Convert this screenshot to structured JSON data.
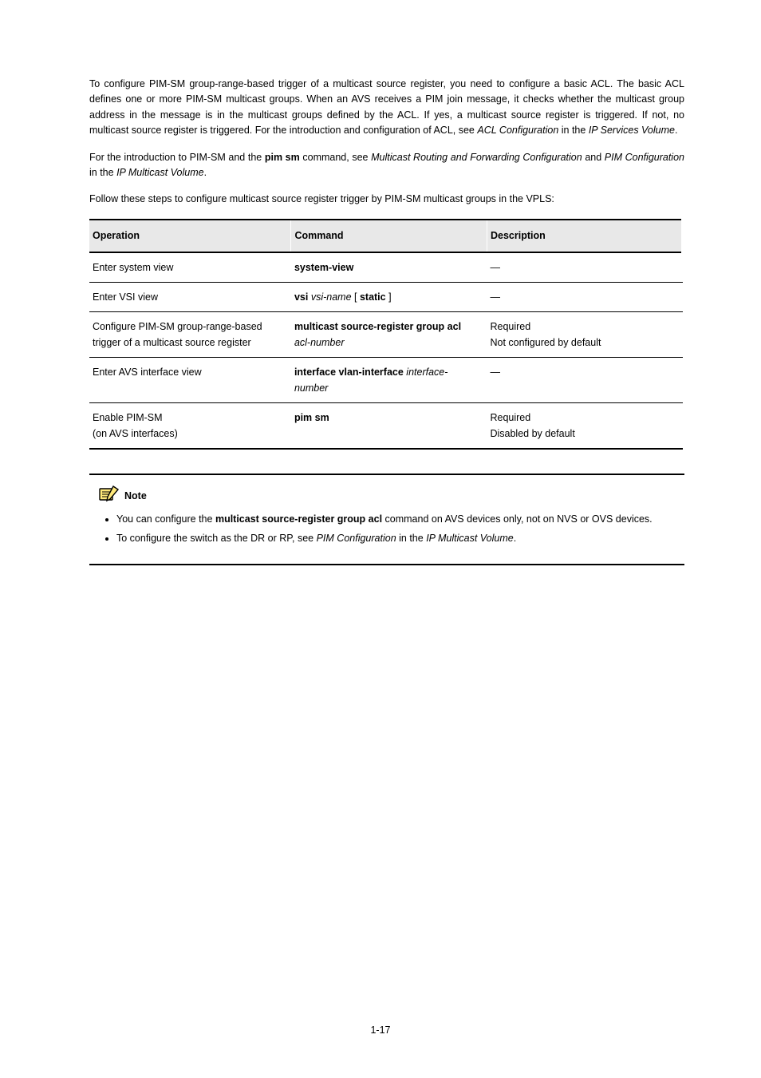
{
  "para1_pre": "To configure PIM-SM group-range-based trigger of a multicast source register, you need to configure a basic ACL. The basic ACL defines one or more PIM-SM multicast groups. When an AVS receives a PIM join message, it checks whether the multicast group address in the message is in the multicast groups defined by the ACL. If yes, a multicast source register is triggered. If not, no multicast source register is triggered. For the introduction and configuration of ACL, see ",
  "para1_link": "ACL Configuration",
  "para1_post": " in the ",
  "para1_em": "IP Services Volume",
  "para1_tail": ".",
  "para2_pre": "For the introduction to PIM-SM and the ",
  "para2_bold": "pim sm",
  "para2_mid": " command, see ",
  "para2_link": "Multicast Routing and Forwarding Configuration",
  "para2_post": " and ",
  "para2_link2": "PIM Configuration",
  "para2_post2": " in the ",
  "para2_em": "IP Multicast Volume",
  "para2_tail": ".",
  "table_caption_pre": "Follow these steps to configure multicast source register trigger by PIM-SM multicast groups in the VPLS:",
  "table": {
    "headers": [
      "Operation",
      "Command",
      "Description"
    ],
    "rows": [
      {
        "op": "Enter system view",
        "cmd_bold": "system-view",
        "cmd_arg": "",
        "desc": "—"
      },
      {
        "op": "Enter VSI view",
        "cmd_bold": "vsi",
        "cmd_arg": " vsi-name ",
        "cmd_tail": "[ ",
        "cmd_bold2": "static",
        "cmd_tail2": " ]",
        "desc": "—"
      },
      {
        "op": "Configure PIM-SM group-range-based trigger of a multicast source register",
        "cmd_bold": "multicast source-register group acl",
        "cmd_arg": " acl-number",
        "desc": "Required\nNot configured by default"
      },
      {
        "op": "Enter AVS interface view",
        "cmd_bold": "interface vlan-interface",
        "cmd_arg": " interface-number",
        "desc": "—"
      },
      {
        "op_line1": "Enable PIM-SM",
        "op_line2": "(on AVS interfaces)",
        "cmd_bold": "pim sm",
        "desc": "Required\nDisabled by default"
      }
    ]
  },
  "note_label": "Note",
  "note_items": [
    {
      "pre": "You can configure the ",
      "bold": "multicast source-register group acl",
      "post": " command on AVS devices only, not on NVS or OVS devices."
    },
    {
      "pre": "To configure the switch as the DR or RP, see ",
      "link": "PIM Configuration",
      "mid": " in the ",
      "em": "IP Multicast Volume",
      "post": "."
    }
  ],
  "page_number": "1-17"
}
